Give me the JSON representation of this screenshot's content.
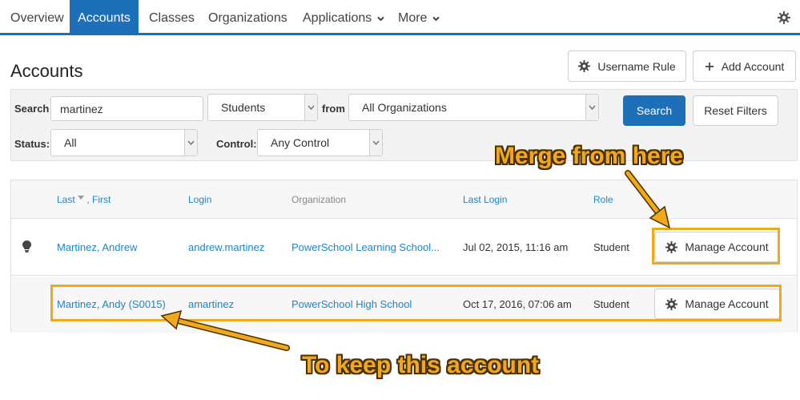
{
  "nav": {
    "tabs": [
      {
        "label": "Overview"
      },
      {
        "label": "Accounts"
      },
      {
        "label": "Classes"
      },
      {
        "label": "Organizations"
      },
      {
        "label": "Applications",
        "has_caret": true
      },
      {
        "label": "More",
        "has_caret": true
      }
    ],
    "settings_icon": "gear-icon"
  },
  "page": {
    "title": "Accounts",
    "username_rule_label": "Username Rule",
    "add_account_label": "Add Account"
  },
  "filters": {
    "search_label": "Search",
    "search_value": "martinez",
    "type_value": "Students",
    "from_label": "from",
    "org_value": "All Organizations",
    "search_button": "Search",
    "reset_button": "Reset Filters",
    "status_label": "Status:",
    "status_value": "All",
    "control_label": "Control:",
    "control_value": "Any Control"
  },
  "table": {
    "headers": {
      "last": "Last",
      "first": ", First",
      "login": "Login",
      "organization": "Organization",
      "last_login": "Last Login",
      "role": "Role"
    },
    "rows": [
      {
        "name": "Martinez, Andrew",
        "login": "andrew.martinez",
        "organization": "PowerSchool Learning School...",
        "last_login": "Jul 02, 2015, 11:16 am",
        "role": "Student",
        "action": "Manage Account",
        "icon": "lightbulb-icon"
      },
      {
        "name": "Martinez, Andy (S0015)",
        "login": "amartinez",
        "organization": "PowerSchool High School",
        "last_login": "Oct 17, 2016, 07:06 am",
        "role": "Student",
        "action": "Manage Account"
      }
    ]
  },
  "annotations": {
    "merge_text": "Merge from here",
    "keep_text": "To keep this account",
    "color": "#f2a81b"
  },
  "colors": {
    "brand": "#1d6fb8",
    "link": "#1d86c8"
  }
}
